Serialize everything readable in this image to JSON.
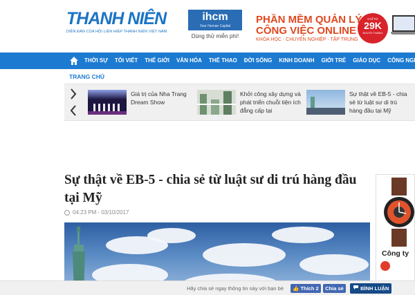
{
  "header": {
    "logo_text": "THANH NIÊN",
    "logo_tagline": "DIỄN ĐÀN CỦA HỘI LIÊN HIỆP THANH NIÊN VIỆT NAM",
    "ihcm_ad": {
      "brand": "ihcm",
      "brand_sub": "Your Human Capital",
      "cta": "Dùng thử miễn phí!"
    },
    "software_ad": {
      "line1": "PHẦN MỀM QUẢN LÝ",
      "line2": "CÔNG VIỆC ONLINE",
      "line3": "KHÓA HỌC - CHUYÊN NGHIỆP - TẬP TRUNG",
      "price_top": "CHỈ TỪ",
      "price": "29K",
      "price_bottom": "NGƯỜI THÁNG"
    }
  },
  "nav": {
    "home_icon": "home-icon",
    "items": [
      "THỜI SỰ",
      "TỐI VIẾT",
      "THẾ GIỚI",
      "VĂN HÓA",
      "THỂ THAO",
      "ĐỜI SỐNG",
      "KINH DOANH",
      "GIỚI TRẺ",
      "GIÁO DỤC",
      "CÔNG NGHỆ"
    ]
  },
  "breadcrumb": "TRANG CHỦ",
  "related": [
    {
      "text": "Giá trị của Nha Trang Dream Show"
    },
    {
      "text": "Khởi công xây dựng và phát triển chuỗi tiện ích đẳng cấp tại"
    },
    {
      "text": "Sự thật về EB-5 - chia sẻ từ luật sư di trú hàng đầu tại Mỹ"
    }
  ],
  "article": {
    "title": "Sự thật về EB-5 - chia sẻ từ luật sư di trú hàng đầu tại Mỹ",
    "timestamp": "04:23 PM - 03/10/2017"
  },
  "side_ad": {
    "heading": "Công ty"
  },
  "share_bar": {
    "prompt": "Hãy chia sẻ ngay thông tin này với bạn bè",
    "like_label": "Thích 2",
    "share_label": "Chia sẻ",
    "comment_label": "BÌNH LUẬN"
  },
  "colors": {
    "brand_blue": "#1c7ad1",
    "promo_orange": "#e0481f",
    "facebook_blue": "#4267b2"
  }
}
